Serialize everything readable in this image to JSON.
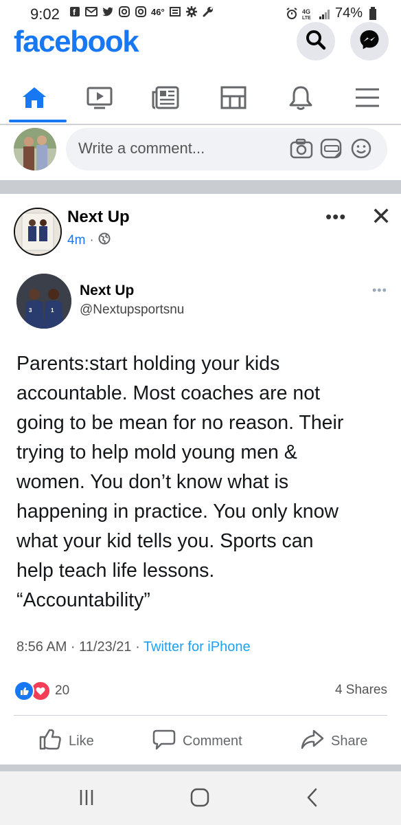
{
  "status_bar": {
    "time": "9:02",
    "temp": "46°",
    "network": "4G LTE",
    "battery": "74%"
  },
  "header": {
    "logo": "facebook",
    "search_icon": "search-icon",
    "messenger_icon": "messenger-icon"
  },
  "nav": {
    "items": [
      "home",
      "watch",
      "news",
      "marketplace",
      "notifications",
      "menu"
    ],
    "active": "home"
  },
  "composer": {
    "placeholder": "Write a comment..."
  },
  "post": {
    "author": "Next Up",
    "time": "4m",
    "dots": "•••",
    "close": "✕"
  },
  "tweet": {
    "name": "Next Up",
    "handle": "@Nextupsportsnu",
    "dots": "•••",
    "lines": [
      "Parents:start holding your kids",
      "accountable. Most coaches are not",
      "going to be mean for no reason. Their",
      "trying to help mold young men &",
      "women. You don’t know what is",
      "happening in practice. You only know",
      "what your kid tells you. Sports can",
      "help teach life lessons.",
      "“Accountability”"
    ],
    "timestamp": "8:56 AM · 11/23/21 · ",
    "source": "Twitter for iPhone"
  },
  "reactions": {
    "count": "20",
    "shares": "4 Shares"
  },
  "actions": {
    "like": "Like",
    "comment": "Comment",
    "share": "Share"
  },
  "colors": {
    "brand": "#1877f2",
    "twitter": "#1da1f2",
    "love": "#f33e58"
  }
}
